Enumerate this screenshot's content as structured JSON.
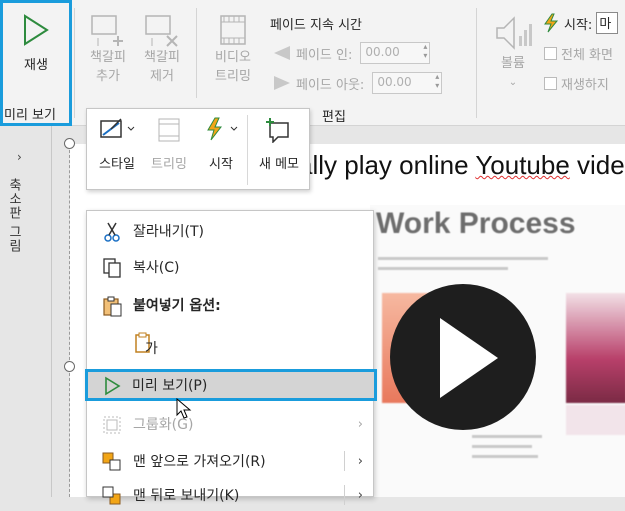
{
  "ribbon": {
    "play": {
      "label": "재생"
    },
    "add_bookmark": {
      "line1": "책갈피",
      "line2": "추가"
    },
    "remove_bookmark": {
      "line1": "책갈피",
      "line2": "제거"
    },
    "trim_video": {
      "line1": "비디오",
      "line2": "트리밍"
    },
    "fade_duration_label": "페이드 지속 시간",
    "fade_in": {
      "label": "페이드 인:",
      "value": "00.00"
    },
    "fade_out": {
      "label": "페이드 아웃:",
      "value": "00.00"
    },
    "volume": {
      "label": "볼륨"
    },
    "start": {
      "label": "시작:",
      "value": "마"
    },
    "fullscreen": {
      "label": "전체 화면"
    },
    "hide_when_not_playing": {
      "label": "재생하지"
    },
    "group_preview": "미리 보기",
    "group_edit": "편집"
  },
  "left_panel": {
    "thumbnails_label": "축소판 그림",
    "collapse_arrow": "›"
  },
  "slide": {
    "title_before": "ally play online ",
    "title_spell": "Youtube",
    "title_after": " videos",
    "video_thumb_title": "Work Process"
  },
  "mini_toolbar": {
    "items": [
      {
        "label": "스타일"
      },
      {
        "label": "트리밍"
      },
      {
        "label": "시작"
      },
      {
        "label": "새 메모"
      }
    ]
  },
  "context_menu": {
    "items": [
      {
        "label": "잘라내기(T)",
        "icon": "scissors-icon"
      },
      {
        "label": "복사(C)",
        "icon": "copy-icon"
      },
      {
        "label": "붙여넣기 옵션:",
        "icon": "paste-icon"
      },
      {
        "label": "가",
        "icon": "paste-text-only-icon"
      },
      {
        "label": "미리 보기(P)",
        "icon": "play-icon"
      },
      {
        "label": "그룹화(G)",
        "icon": "group-icon"
      },
      {
        "label": "맨 앞으로 가져오기(R)",
        "icon": "bring-to-front-icon"
      },
      {
        "label": "맨 뒤로 보내기(K)",
        "icon": "send-to-back-icon"
      }
    ],
    "submenu_arrow": "›"
  },
  "colors": {
    "accent": "#1a9cdc",
    "play_green": "#2e8b3e",
    "ribbon_bg": "#f3f3f3",
    "disabled": "#a6a6a6"
  }
}
